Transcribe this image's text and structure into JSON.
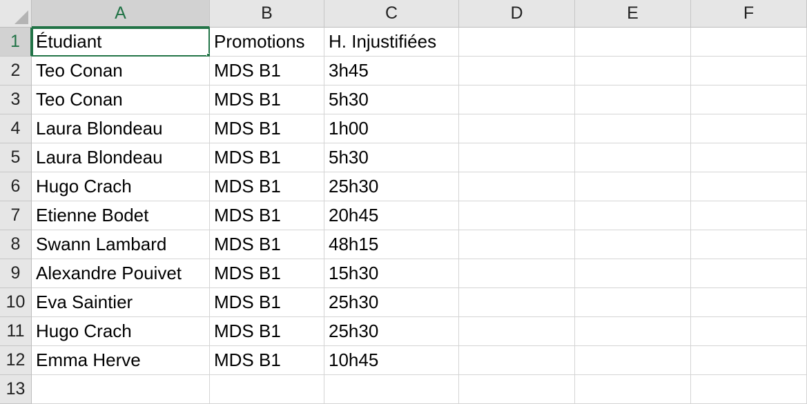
{
  "columns": [
    "A",
    "B",
    "C",
    "D",
    "E",
    "F"
  ],
  "row_numbers": [
    "1",
    "2",
    "3",
    "4",
    "5",
    "6",
    "7",
    "8",
    "9",
    "10",
    "11",
    "12",
    "13"
  ],
  "rows": [
    [
      "Étudiant",
      "Promotions",
      "H. Injustifiées",
      "",
      "",
      ""
    ],
    [
      "Teo Conan",
      "MDS B1",
      "3h45",
      "",
      "",
      ""
    ],
    [
      "Teo Conan",
      "MDS B1",
      "5h30",
      "",
      "",
      ""
    ],
    [
      "Laura Blondeau",
      "MDS B1",
      "1h00",
      "",
      "",
      ""
    ],
    [
      "Laura Blondeau",
      "MDS B1",
      "5h30",
      "",
      "",
      ""
    ],
    [
      "Hugo Crach",
      "MDS B1",
      "25h30",
      "",
      "",
      ""
    ],
    [
      "Etienne Bodet",
      "MDS B1",
      "20h45",
      "",
      "",
      ""
    ],
    [
      "Swann Lambard",
      "MDS B1",
      "48h15",
      "",
      "",
      ""
    ],
    [
      "Alexandre Pouivet",
      "MDS B1",
      "15h30",
      "",
      "",
      ""
    ],
    [
      "Eva Saintier",
      "MDS B1",
      "25h30",
      "",
      "",
      ""
    ],
    [
      "Hugo Crach",
      "MDS B1",
      "25h30",
      "",
      "",
      ""
    ],
    [
      "Emma Herve",
      "MDS B1",
      "10h45",
      "",
      "",
      ""
    ],
    [
      "",
      "",
      "",
      "",
      "",
      ""
    ]
  ],
  "selection": {
    "active_cell": "A1",
    "accent_color": "#217346"
  }
}
